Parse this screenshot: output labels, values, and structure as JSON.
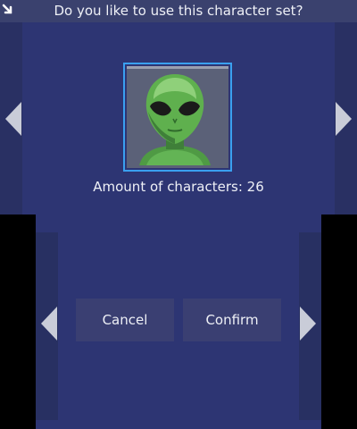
{
  "header": {
    "title": "Do you like to use this character set?",
    "back_icon": "back-arrow-icon"
  },
  "preview": {
    "image": "alien-character-icon",
    "count_text": "Amount of characters: 26"
  },
  "buttons": {
    "cancel_label": "Cancel",
    "confirm_label": "Confirm"
  },
  "colors": {
    "background": "#2d3573",
    "selection_border": "#3aa0f0",
    "button": "#3a3f72",
    "alien_green": "#5fb04e"
  }
}
